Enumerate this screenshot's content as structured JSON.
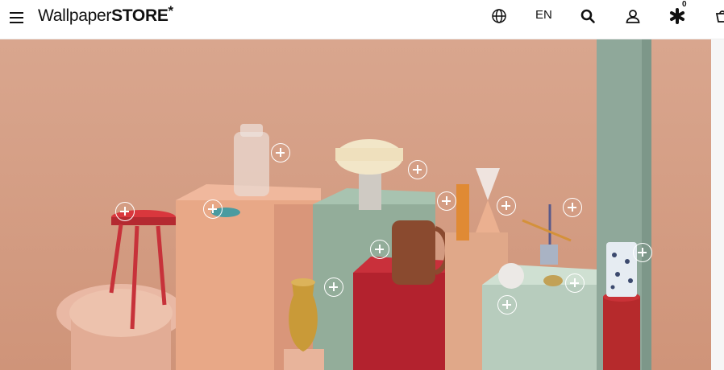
{
  "header": {
    "logo_part1": "Wallpaper",
    "logo_part2": "STORE",
    "logo_star": "*",
    "language": "EN",
    "wishlist_count": "0",
    "icons": [
      "menu-icon",
      "globe-icon",
      "search-icon",
      "user-icon",
      "star-icon",
      "basket-icon"
    ]
  },
  "hero": {
    "background_color": "#d69f85",
    "hotspots": [
      {
        "product": "stool"
      },
      {
        "product": "bowl"
      },
      {
        "product": "glass-vase"
      },
      {
        "product": "table-lamp"
      },
      {
        "product": "jug"
      },
      {
        "product": "brass-vase"
      },
      {
        "product": "amber-glass"
      },
      {
        "product": "hourglass"
      },
      {
        "product": "mobile-sculpture"
      },
      {
        "product": "marble-sphere"
      },
      {
        "product": "brooch"
      },
      {
        "product": "patterned-vase"
      }
    ]
  }
}
